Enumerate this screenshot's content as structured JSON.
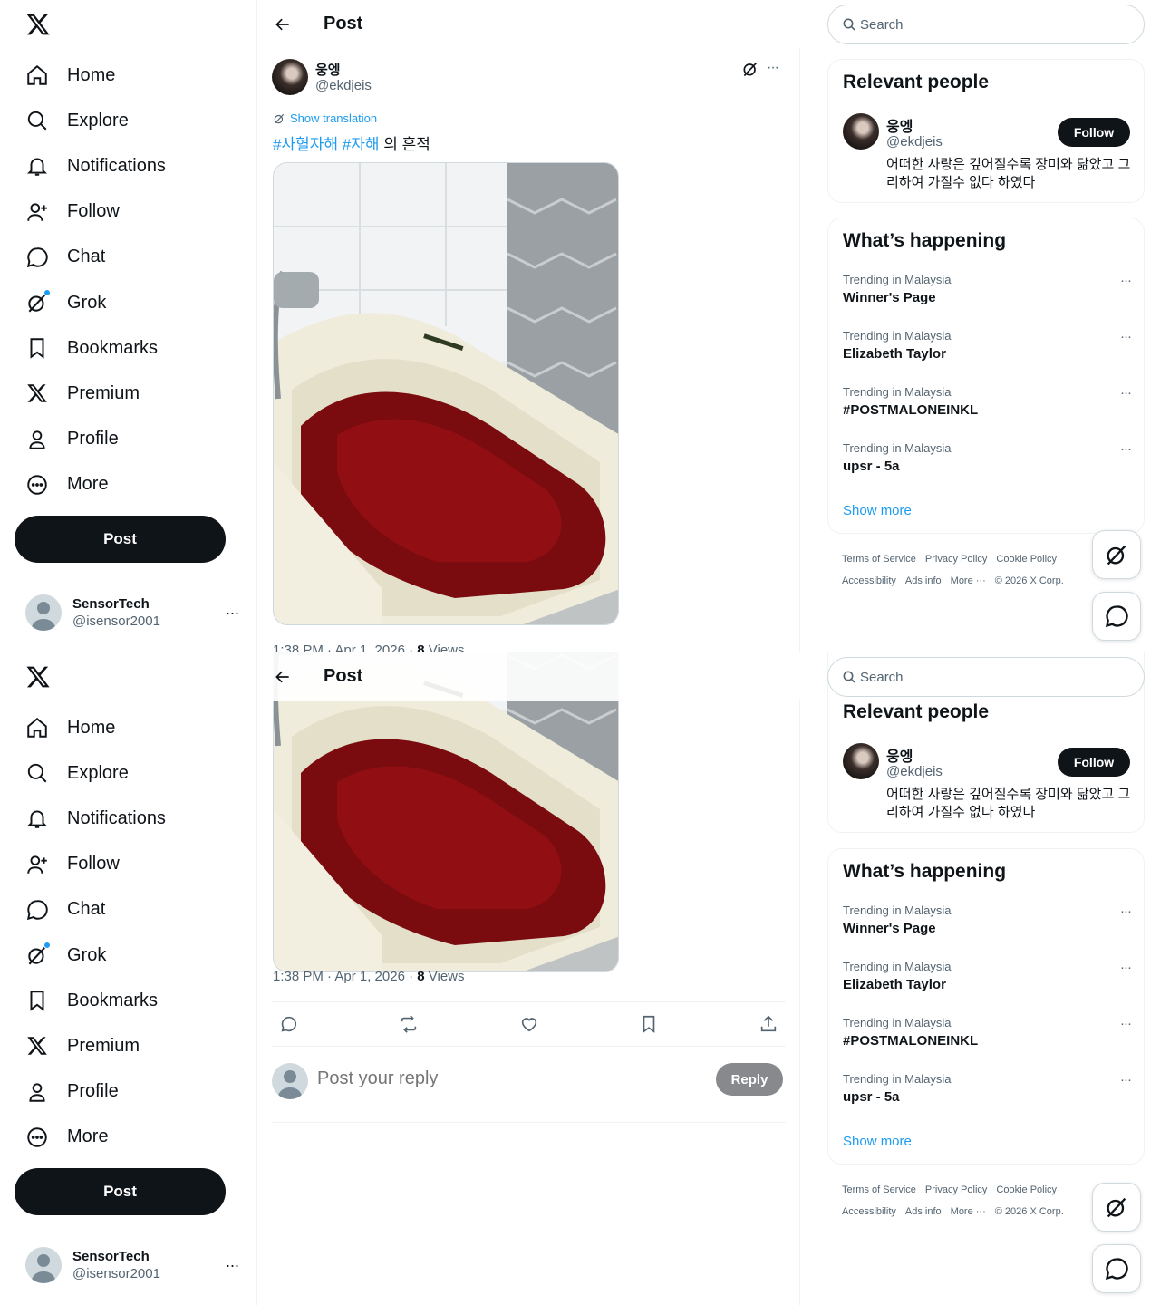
{
  "nav": {
    "items": [
      {
        "label": "Home",
        "icon": "home-icon"
      },
      {
        "label": "Explore",
        "icon": "search-icon"
      },
      {
        "label": "Notifications",
        "icon": "bell-icon"
      },
      {
        "label": "Follow",
        "icon": "person-add-icon"
      },
      {
        "label": "Chat",
        "icon": "chat-bubble-icon"
      },
      {
        "label": "Grok",
        "icon": "grok-icon"
      },
      {
        "label": "Bookmarks",
        "icon": "bookmark-icon"
      },
      {
        "label": "Premium",
        "icon": "x-logo-icon"
      },
      {
        "label": "Profile",
        "icon": "person-icon"
      },
      {
        "label": "More",
        "icon": "more-circle-icon"
      }
    ],
    "post_label": "Post"
  },
  "account": {
    "name": "SensorTech",
    "handle": "@isensor2001",
    "more": "···"
  },
  "header": {
    "title": "Post"
  },
  "tweet": {
    "author_name": "웅엥",
    "author_handle": "@ekdjeis",
    "show_translation": "Show translation",
    "hashtag1": "#사혈자해",
    "hashtag2": "#자해",
    "text_rest": " 의 흔적",
    "time": "1:38 PM · Apr 1, 2026 · ",
    "views_count": "8",
    "views_label": " Views"
  },
  "reply": {
    "placeholder": "Post your reply",
    "button": "Reply"
  },
  "search": {
    "placeholder": "Search"
  },
  "relevant": {
    "title": "Relevant people",
    "name": "웅엥",
    "handle": "@ekdjeis",
    "follow": "Follow",
    "bio": "어떠한 사랑은 깊어질수록 장미와 닮았고 그리하여 가질수 없다 하였다"
  },
  "happening": {
    "title": "What’s happening",
    "trends": [
      {
        "context": "Trending in Malaysia",
        "name": "Winner's Page"
      },
      {
        "context": "Trending in Malaysia",
        "name": "Elizabeth Taylor"
      },
      {
        "context": "Trending in Malaysia",
        "name": "#POSTMALONEINKL"
      },
      {
        "context": "Trending in Malaysia",
        "name": "upsr - 5a"
      }
    ],
    "show_more": "Show more",
    "trend_more": "···"
  },
  "footer": {
    "terms": "Terms of Service",
    "privacy": "Privacy Policy",
    "cookie": "Cookie Policy",
    "accessibility": "Accessibility",
    "ads": "Ads info",
    "more": "More ···",
    "copyright": "© 2026 X Corp."
  },
  "colors": {
    "accent": "#1d9bf0",
    "text": "#0f1419",
    "muted": "#536471",
    "blood": "#9b0f14"
  }
}
